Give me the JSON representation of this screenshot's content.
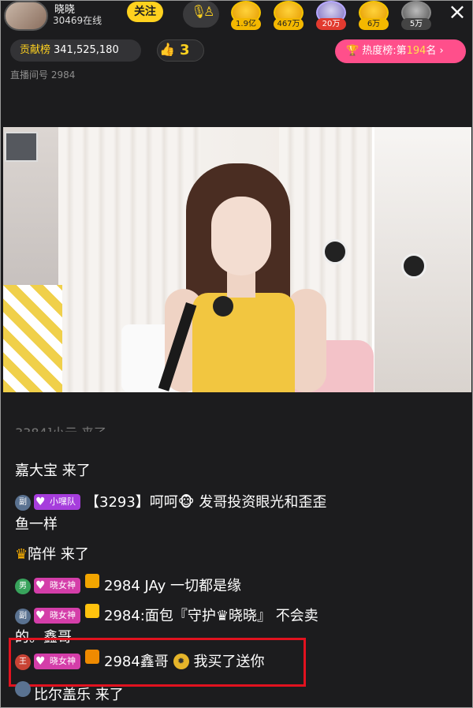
{
  "header": {
    "host_name": "晓晓",
    "online_count": "30469在线",
    "follow_label": "关注",
    "viewers": [
      {
        "count": "1.9亿",
        "style": "gold"
      },
      {
        "count": "467万",
        "style": "gold"
      },
      {
        "count": "20万",
        "style": "purple"
      },
      {
        "count": "6万",
        "style": "gold"
      },
      {
        "count": "5万",
        "style": "gray"
      }
    ],
    "close_icon": "×"
  },
  "stats": {
    "contrib_label": "贡献榜",
    "contrib_value": "341,525,180",
    "thumb_count": "3",
    "rank_label": "热度榜:第",
    "rank_value": "194",
    "rank_suffix": "名",
    "room_id": "直播间号 2984"
  },
  "chat": {
    "partial_top": "3384]小云 来了",
    "messages": [
      {
        "user": "嘉大宝",
        "text": "来了"
      },
      {
        "level": "副",
        "tag": "小嘿队",
        "text": "【3293】呵呵🐵 发哥投资眼光和歪歪",
        "text2": "鱼一样"
      },
      {
        "user": "陪伴",
        "text": "来了"
      },
      {
        "level": "男",
        "tag": "晓女神",
        "text": "2984 JAy 一切都是缘"
      },
      {
        "level": "副",
        "tag": "晓女神",
        "text": "2984:面包『守护♛晓晓』 不会卖",
        "text2": "的。鑫哥"
      },
      {
        "level": "王",
        "tag": "晓女神",
        "user": "2984鑫哥",
        "text": "我买了送你"
      },
      {
        "user": "比尔盖乐",
        "text": "来了"
      }
    ]
  },
  "colors": {
    "accent_yellow": "#ffd21f",
    "rank_pink": "#ff4f8b",
    "highlight_red": "#e1121f"
  }
}
